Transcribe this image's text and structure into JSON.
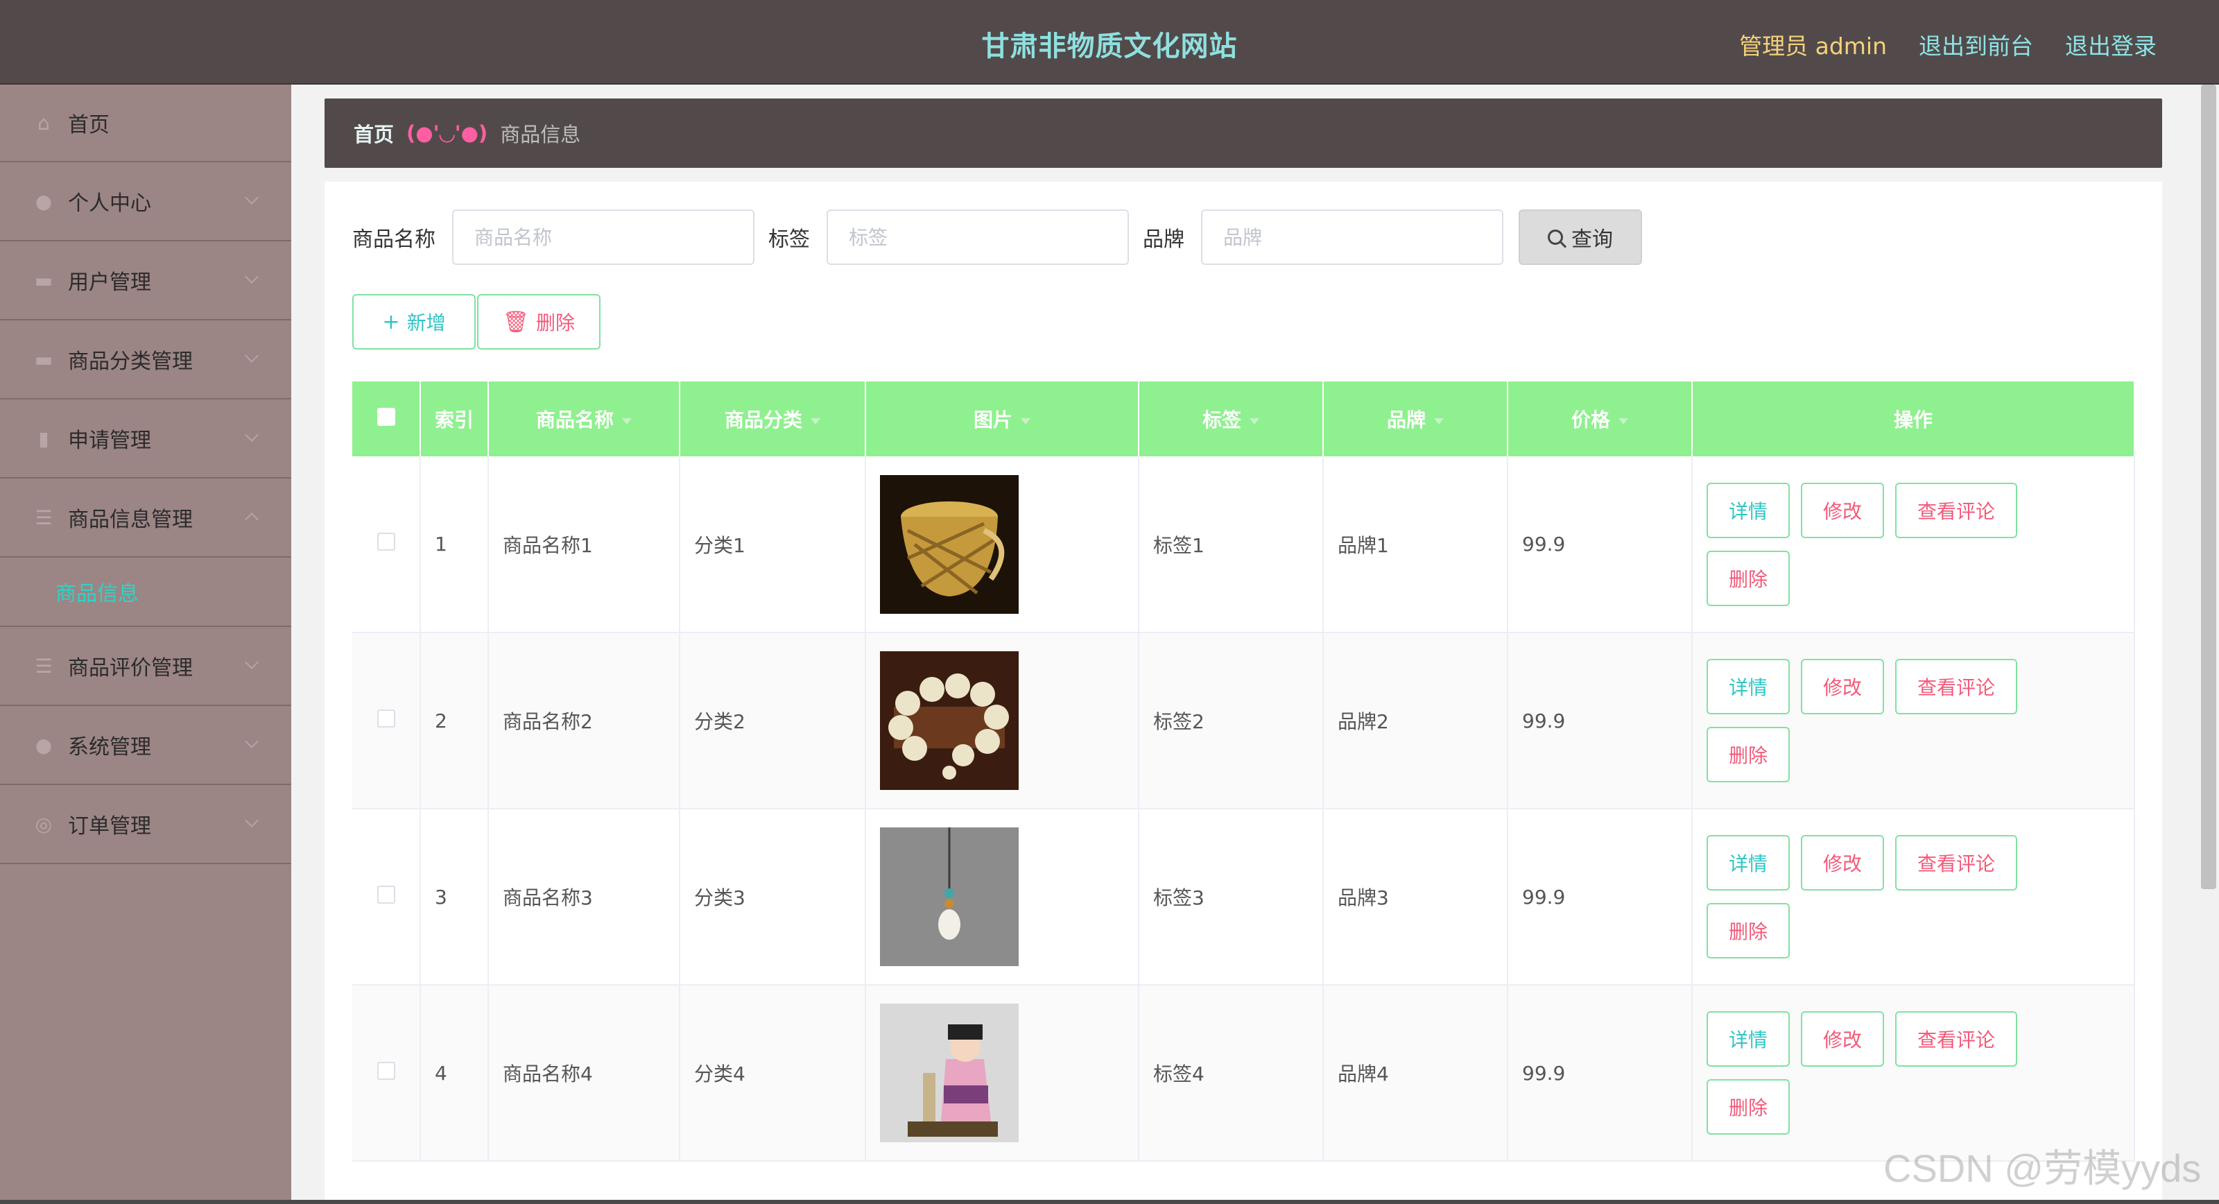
{
  "header": {
    "title": "甘肃非物质文化网站",
    "user_label": "管理员 admin",
    "links": [
      "退出到前台",
      "退出登录"
    ]
  },
  "sidebar": {
    "items": [
      {
        "label": "首页",
        "icon": "home-icon"
      },
      {
        "label": "个人中心",
        "icon": "user-icon"
      },
      {
        "label": "用户管理",
        "icon": "monitor-icon"
      },
      {
        "label": "商品分类管理",
        "icon": "folder-icon"
      },
      {
        "label": "申请管理",
        "icon": "mic-icon"
      },
      {
        "label": "商品信息管理",
        "icon": "list-icon"
      },
      {
        "label": "商品评价管理",
        "icon": "list-icon"
      },
      {
        "label": "系统管理",
        "icon": "location-icon"
      },
      {
        "label": "订单管理",
        "icon": "globe-icon"
      }
    ],
    "active_sub": "商品信息"
  },
  "breadcrumb": {
    "home": "首页",
    "separator": "(●'◡'●)",
    "current": "商品信息"
  },
  "search": {
    "name_label": "商品名称",
    "name_placeholder": "商品名称",
    "tag_label": "标签",
    "tag_placeholder": "标签",
    "brand_label": "品牌",
    "brand_placeholder": "品牌",
    "query_button": "查询"
  },
  "actions": {
    "add": "新增",
    "delete": "删除"
  },
  "table": {
    "headers": [
      "索引",
      "商品名称",
      "商品分类",
      "图片",
      "标签",
      "品牌",
      "价格",
      "操作"
    ],
    "rows": [
      {
        "index": "1",
        "name": "商品名称1",
        "category": "分类1",
        "image": "bamboo-basket",
        "tag": "标签1",
        "brand": "品牌1",
        "price": "99.9"
      },
      {
        "index": "2",
        "name": "商品名称2",
        "category": "分类2",
        "image": "bead-bracelet",
        "tag": "标签2",
        "brand": "品牌2",
        "price": "99.9"
      },
      {
        "index": "3",
        "name": "商品名称3",
        "category": "分类3",
        "image": "pendant",
        "tag": "标签3",
        "brand": "品牌3",
        "price": "99.9"
      },
      {
        "index": "4",
        "name": "商品名称4",
        "category": "分类4",
        "image": "figurine",
        "tag": "标签4",
        "brand": "品牌4",
        "price": "99.9"
      }
    ],
    "row_actions": {
      "detail": "详情",
      "edit": "修改",
      "review": "查看评论",
      "remove": "删除"
    }
  },
  "watermark": "CSDN @劳模yyds",
  "colors": {
    "header_bg": "#524a4a",
    "sidebar_bg": "#9c8585",
    "table_header": "#8ff08f",
    "accent_teal": "#2fc4c4",
    "accent_pink": "#f35a7a"
  }
}
